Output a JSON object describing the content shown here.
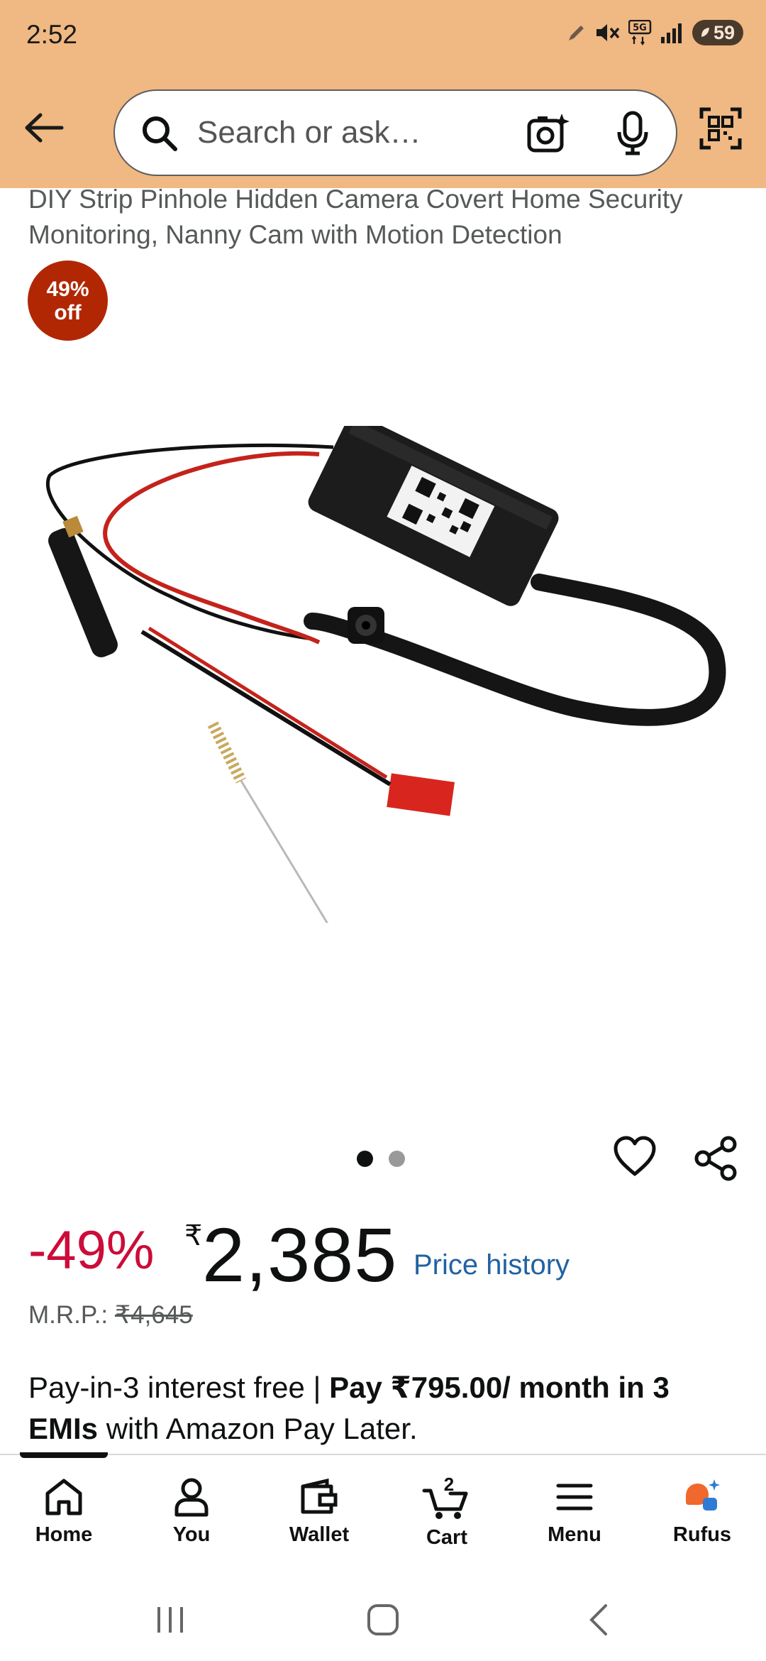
{
  "status_bar": {
    "time": "2:52",
    "battery": "59"
  },
  "search": {
    "placeholder": "Search or ask a question"
  },
  "product": {
    "title": "DIY Strip Pinhole Hidden Camera Covert Home Security Monitoring, Nanny Cam with Motion Detection",
    "badge_percent": "49%",
    "badge_off": "off",
    "image_count": 2,
    "active_image": 1
  },
  "price": {
    "discount": "-49%",
    "currency": "₹",
    "value": "2,385",
    "history_link": "Price history",
    "mrp_label": "M.R.P.:",
    "mrp_value": "₹4,645"
  },
  "emi": {
    "part1": "Pay-in-3 interest free | ",
    "part2": "Pay ₹795.00/ month in 3 EMIs",
    "part3": " with Amazon Pay Later."
  },
  "bottom_nav": {
    "home": "Home",
    "you": "You",
    "wallet": "Wallet",
    "cart": "Cart",
    "cart_count": "2",
    "menu": "Menu",
    "rufus": "Rufus"
  },
  "colors": {
    "header_bg": "#f0b882",
    "discount_red": "#cc0c39",
    "badge_red": "#b12704",
    "link_blue": "#2162a1"
  }
}
